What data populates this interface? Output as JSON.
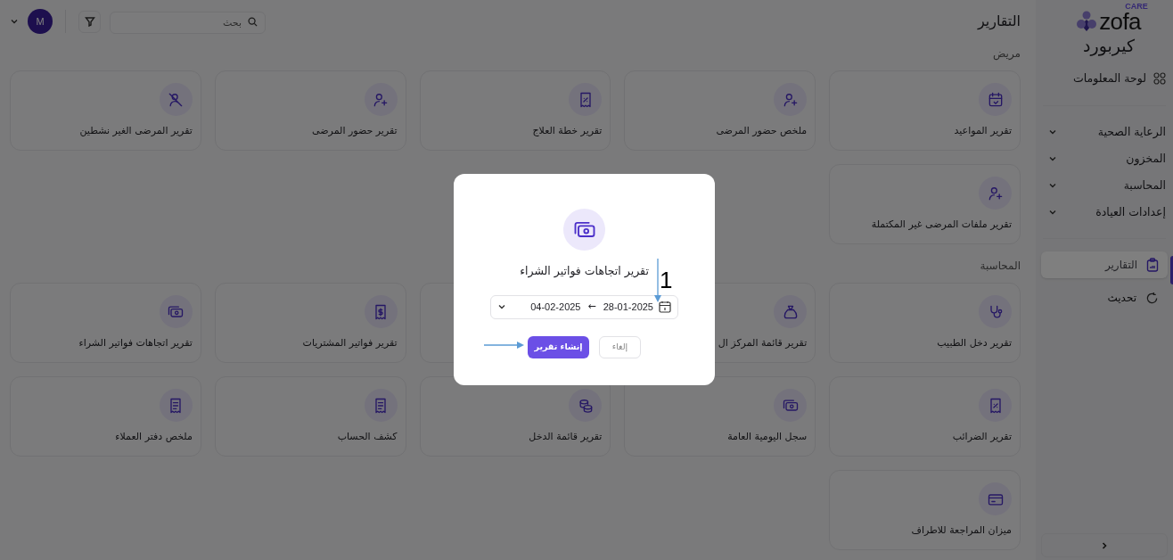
{
  "sidebar": {
    "logo": {
      "wordmark": "zofa",
      "tag": "CARE"
    },
    "clinic_name": "كيربورد",
    "dashboard": "لوحة المعلومات",
    "groups": [
      {
        "label": "الرعاية الصحية",
        "expanded": false
      },
      {
        "label": "المخزون",
        "expanded": false
      },
      {
        "label": "المحاسبة",
        "expanded": false
      },
      {
        "label": "إعدادات العيادة",
        "expanded": false
      }
    ],
    "items": [
      {
        "label": "التقارير",
        "selected": true
      },
      {
        "label": "تحديث",
        "selected": false
      }
    ]
  },
  "header": {
    "title": "التقارير",
    "search": {
      "placeholder": "بحث"
    },
    "avatar": "M"
  },
  "sections": [
    {
      "title": "مريض",
      "cards": [
        {
          "title": "تقرير المواعيد"
        },
        {
          "title": "ملخص حضور المرضى"
        },
        {
          "title": "تقرير خطة العلاج"
        },
        {
          "title": "تقرير حضور المرضى"
        },
        {
          "title": "تقرير المرضى الغير نشطين"
        },
        {
          "title": "تقرير ملفات المرضى غير المكتملة"
        }
      ]
    },
    {
      "title": "المحاسبة",
      "cards": [
        {
          "title": "تقرير دخل الطبيب"
        },
        {
          "title": "تقرير قائمة المركز ال"
        },
        {
          "title": "تقرير فواتير المشتريات"
        },
        {
          "title": "تقرير اتجاهات فواتير الشراء"
        },
        {
          "title": "تقرير الضرائب"
        },
        {
          "title": "سجل اليومية العامة"
        },
        {
          "title": "تقرير قائمة الدخل"
        },
        {
          "title": "كشف الحساب"
        },
        {
          "title": "ملخص دفتر العملاء"
        },
        {
          "title": "ميزان المراجعة للاطراف"
        }
      ]
    }
  ],
  "modal": {
    "title": "تقرير اتجاهات فواتير الشراء",
    "date_from": "28-01-2025",
    "separator": "←",
    "date_to": "04-02-2025",
    "buttons": [
      {
        "label": "إلغاء",
        "kind": "secondary"
      },
      {
        "label": "إنشاء تقرير",
        "kind": "primary"
      }
    ]
  },
  "annotation": {
    "number": "1"
  }
}
